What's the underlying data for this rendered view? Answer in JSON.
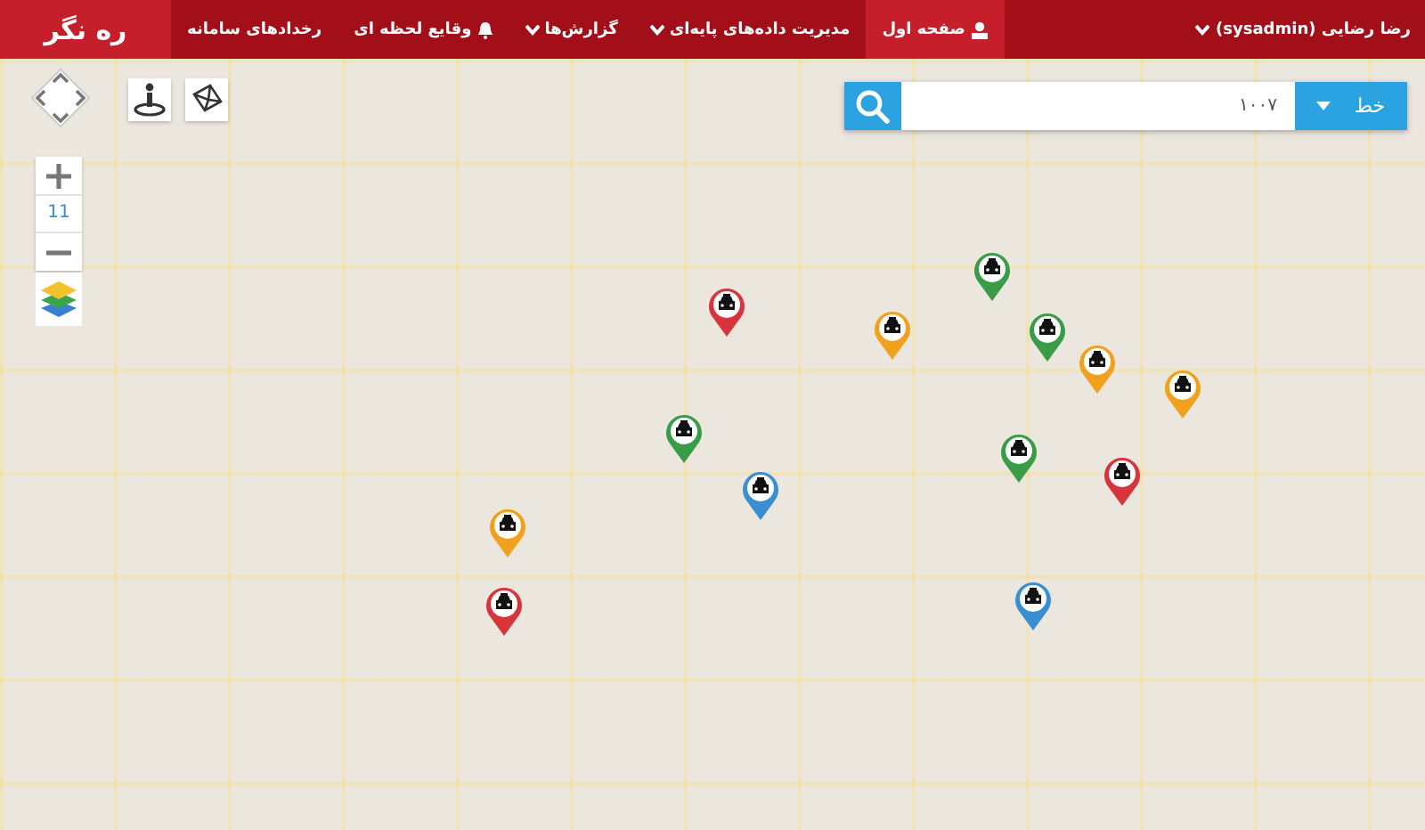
{
  "navbar": {
    "brand": "ره نگر",
    "items": [
      {
        "label": "صفحه اول",
        "kind": "home",
        "selected": true
      },
      {
        "label": "مدیریت داده‌های پایه‌ای",
        "kind": "menu",
        "selected": false
      },
      {
        "label": "گزارش‌ها",
        "kind": "menu",
        "selected": false
      },
      {
        "label": "وقایع لحظه ای",
        "kind": "events",
        "selected": false
      },
      {
        "label": "رخدادهای سامانه",
        "kind": "link",
        "selected": false
      }
    ],
    "user": "رضا رضایی (sysadmin)"
  },
  "search": {
    "type": "خط",
    "value": "۱۰۰۷"
  },
  "zoom": {
    "level": "11"
  },
  "markers": [
    {
      "color": "#d8343c"
    },
    {
      "color": "#f0a21e"
    },
    {
      "color": "#3b9c47"
    },
    {
      "color": "#3b9c47"
    },
    {
      "color": "#f0a21e"
    },
    {
      "color": "#f0a21e"
    },
    {
      "color": "#3b9c47"
    },
    {
      "color": "#3a8fd0"
    },
    {
      "color": "#3b9c47"
    },
    {
      "color": "#d8343c"
    },
    {
      "color": "#f0a21e"
    },
    {
      "color": "#d8343c"
    },
    {
      "color": "#3a8fd0"
    }
  ]
}
